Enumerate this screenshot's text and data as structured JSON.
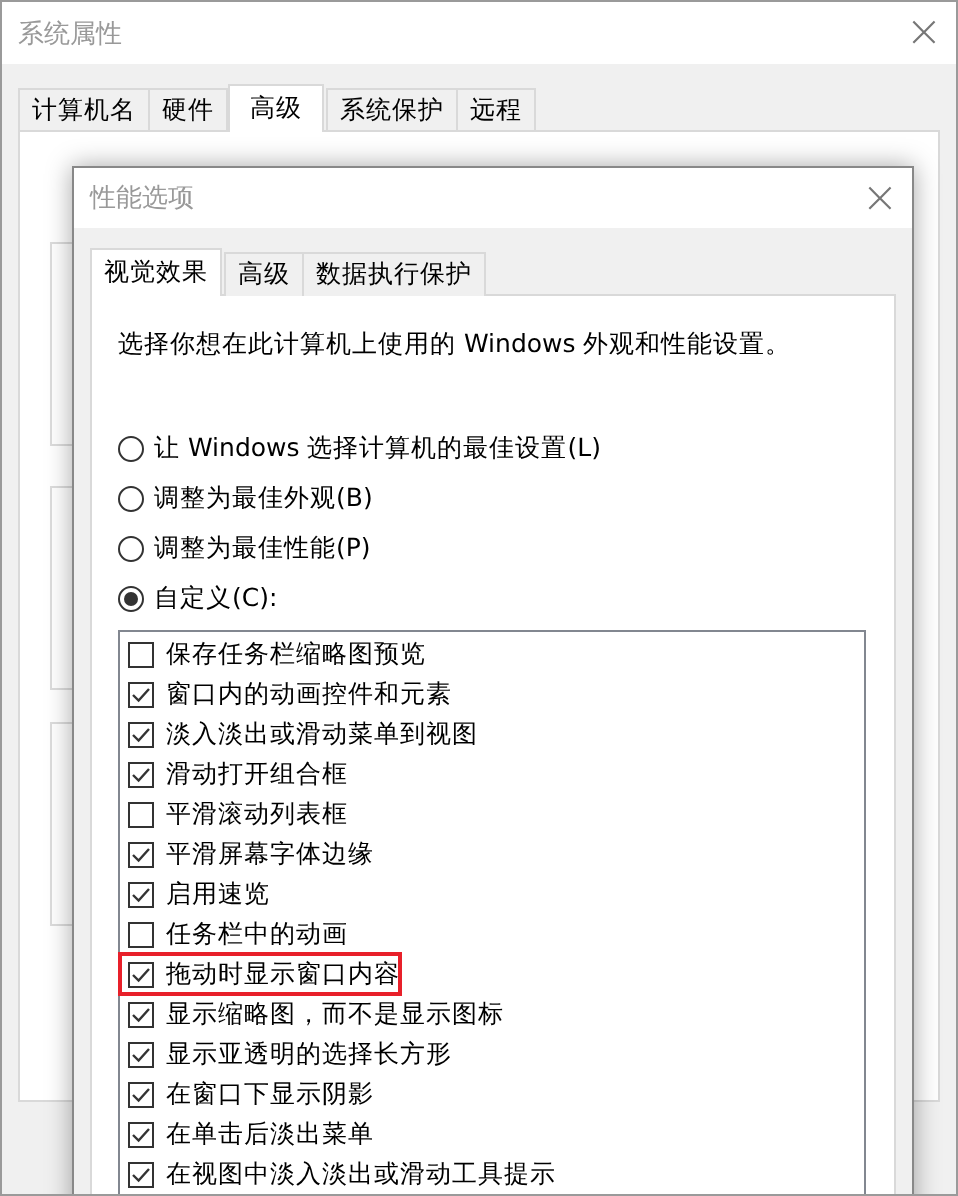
{
  "window": {
    "title": "系统属性",
    "close": "×"
  },
  "tabs": [
    {
      "label": "计算机名",
      "selected": false
    },
    {
      "label": "硬件",
      "selected": false
    },
    {
      "label": "高级",
      "selected": true
    },
    {
      "label": "系统保护",
      "selected": false
    },
    {
      "label": "远程",
      "selected": false
    }
  ],
  "dialog": {
    "title": "性能选项",
    "close": "×",
    "tabs": [
      {
        "label": "视觉效果",
        "selected": true
      },
      {
        "label": "高级",
        "selected": false
      },
      {
        "label": "数据执行保护",
        "selected": false
      }
    ],
    "description": "选择你想在此计算机上使用的 Windows 外观和性能设置。",
    "options": [
      {
        "label": "让 Windows 选择计算机的最佳设置(L)",
        "selected": false
      },
      {
        "label": "调整为最佳外观(B)",
        "selected": false
      },
      {
        "label": "调整为最佳性能(P)",
        "selected": false
      },
      {
        "label": "自定义(C):",
        "selected": true
      }
    ],
    "effects": [
      {
        "label": "保存任务栏缩略图预览",
        "checked": false,
        "highlighted": false
      },
      {
        "label": "窗口内的动画控件和元素",
        "checked": true,
        "highlighted": false
      },
      {
        "label": "淡入淡出或滑动菜单到视图",
        "checked": true,
        "highlighted": false
      },
      {
        "label": "滑动打开组合框",
        "checked": true,
        "highlighted": false
      },
      {
        "label": "平滑滚动列表框",
        "checked": false,
        "highlighted": false
      },
      {
        "label": "平滑屏幕字体边缘",
        "checked": true,
        "highlighted": false
      },
      {
        "label": "启用速览",
        "checked": true,
        "highlighted": false
      },
      {
        "label": "任务栏中的动画",
        "checked": false,
        "highlighted": false
      },
      {
        "label": "拖动时显示窗口内容",
        "checked": true,
        "highlighted": true
      },
      {
        "label": "显示缩略图，而不是显示图标",
        "checked": true,
        "highlighted": false
      },
      {
        "label": "显示亚透明的选择长方形",
        "checked": true,
        "highlighted": false
      },
      {
        "label": "在窗口下显示阴影",
        "checked": true,
        "highlighted": false
      },
      {
        "label": "在单击后淡出菜单",
        "checked": true,
        "highlighted": false
      },
      {
        "label": "在视图中淡入淡出或滑动工具提示",
        "checked": true,
        "highlighted": false
      }
    ]
  }
}
